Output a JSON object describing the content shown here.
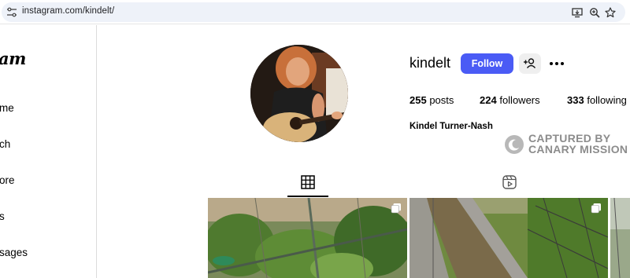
{
  "browser": {
    "url": "instagram.com/kindelt/",
    "icons": [
      "site-info-icon",
      "install-app-icon",
      "zoom-icon",
      "bookmark-star-icon"
    ]
  },
  "sidebar": {
    "logo_text": "am",
    "items": [
      {
        "label": "me",
        "icon": "home-icon"
      },
      {
        "label": "ch",
        "icon": "search-icon"
      },
      {
        "label": "ore",
        "icon": "explore-icon"
      },
      {
        "label": "s",
        "icon": "reels-icon"
      },
      {
        "label": "sages",
        "icon": "messages-icon"
      }
    ]
  },
  "profile": {
    "username": "kindelt",
    "follow_label": "Follow",
    "full_name": "Kindel Turner-Nash",
    "stats": {
      "posts_count": "255",
      "posts_label": "posts",
      "followers_count": "224",
      "followers_label": "followers",
      "following_count": "333",
      "following_label": "following"
    }
  },
  "watermark": {
    "line1": "CAPTURED BY",
    "line2": "CANARY MISSION"
  },
  "tabs": [
    {
      "name": "posts",
      "icon": "grid-icon",
      "active": true
    },
    {
      "name": "reels",
      "icon": "reels-icon",
      "active": false
    }
  ],
  "colors": {
    "follow_button": "#4a5bf5",
    "address_bar": "#eef2f9",
    "watermark": "#8c8c8c"
  }
}
